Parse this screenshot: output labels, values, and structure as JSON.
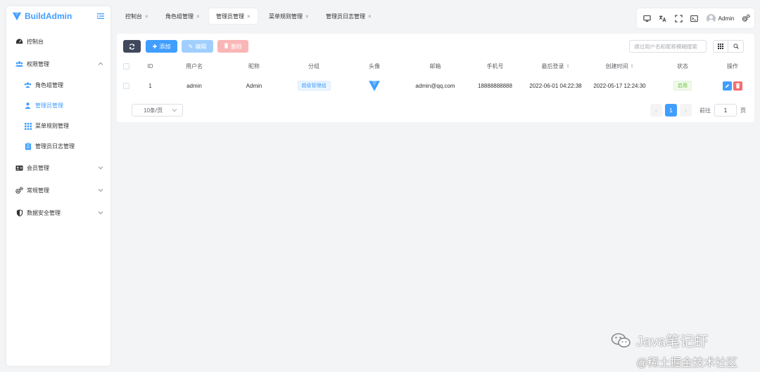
{
  "brand": {
    "name": "BuildAdmin"
  },
  "sidebar": {
    "items": [
      {
        "label": "控制台",
        "icon": "dashboard-icon"
      },
      {
        "label": "权限管理",
        "icon": "users-icon",
        "expanded": true,
        "children": [
          {
            "label": "角色组管理",
            "icon": "user-group-icon"
          },
          {
            "label": "管理员管理",
            "icon": "user-icon",
            "active": true
          },
          {
            "label": "菜单规则管理",
            "icon": "grid-icon"
          },
          {
            "label": "管理员日志管理",
            "icon": "clipboard-icon"
          }
        ]
      },
      {
        "label": "会员管理",
        "icon": "id-card-icon"
      },
      {
        "label": "常规管理",
        "icon": "gears-icon"
      },
      {
        "label": "数据安全管理",
        "icon": "shield-icon"
      }
    ]
  },
  "tabs": [
    {
      "label": "控制台"
    },
    {
      "label": "角色组管理"
    },
    {
      "label": "管理员管理",
      "active": true
    },
    {
      "label": "菜单规则管理"
    },
    {
      "label": "管理员日志管理"
    }
  ],
  "header_tools": {
    "user_name": "Admin"
  },
  "toolbar": {
    "add_label": "添加",
    "edit_label": "编辑",
    "delete_label": "删除",
    "search_placeholder": "通过用户名和昵称模糊搜索"
  },
  "table": {
    "columns": [
      "ID",
      "用户名",
      "昵称",
      "分组",
      "头像",
      "邮箱",
      "手机号",
      "最后登录",
      "创建时间",
      "状态",
      "操作"
    ],
    "rows": [
      {
        "id": "1",
        "username": "admin",
        "nickname": "Admin",
        "group": "超级管理组",
        "email": "admin@qq.com",
        "mobile": "18888888888",
        "last_login": "2022-06-01 04:22:38",
        "created": "2022-05-17 12:24:30",
        "status": "启用"
      }
    ]
  },
  "pagination": {
    "page_size": "10条/页",
    "current": "1",
    "goto_label": "前往",
    "goto_value": "1",
    "page_unit": "页"
  },
  "watermark": {
    "line1": "Java笔记虾",
    "line2": "@稀土掘金技术社区"
  },
  "colors": {
    "primary": "#409eff",
    "danger": "#f56c6c",
    "success": "#67c23a",
    "dark": "#40485b"
  }
}
